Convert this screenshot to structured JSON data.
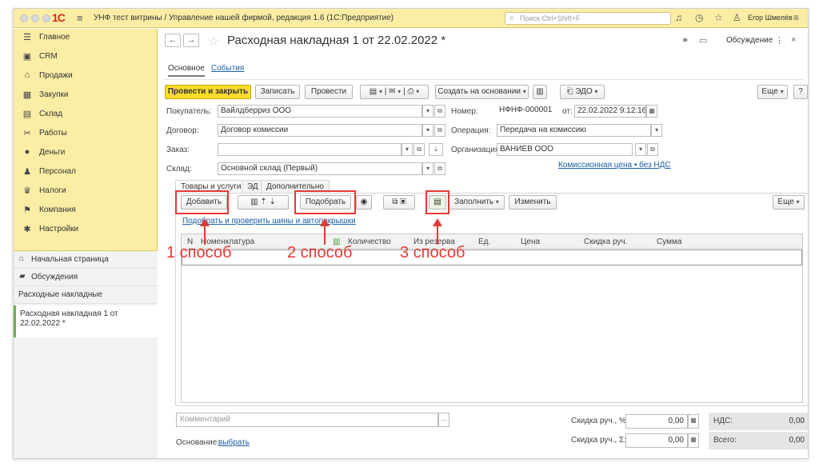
{
  "titlebar": {
    "logo": "1С",
    "app_title": "УНФ тест витрины / Управление нашей фирмой, редакция 1.6  (1С:Предприятие)",
    "search_placeholder": "Поиск Ctrl+Shift+F",
    "user": "Егор Шмелёв"
  },
  "sidebar": {
    "items": [
      {
        "label": "Главное",
        "icon": "menu-icon"
      },
      {
        "label": "CRM",
        "icon": "crm-icon"
      },
      {
        "label": "Продажи",
        "icon": "sales-icon"
      },
      {
        "label": "Закупки",
        "icon": "purchases-icon"
      },
      {
        "label": "Склад",
        "icon": "warehouse-icon"
      },
      {
        "label": "Работы",
        "icon": "works-icon"
      },
      {
        "label": "Деньги",
        "icon": "money-icon"
      },
      {
        "label": "Персонал",
        "icon": "staff-icon"
      },
      {
        "label": "Налоги",
        "icon": "taxes-icon"
      },
      {
        "label": "Компания",
        "icon": "company-icon"
      },
      {
        "label": "Настройки",
        "icon": "settings-icon"
      }
    ],
    "sub": {
      "home": "Начальная страница",
      "discussions": "Обсуждения",
      "invoices": "Расходные накладные",
      "open_window": "Расходная накладная 1 от 22.02.2022 *"
    }
  },
  "doc": {
    "title": "Расходная накладная 1 от 22.02.2022 *",
    "discuss": "Обсуждение",
    "tabs": {
      "main": "Основное",
      "events": "События"
    },
    "toolbar": {
      "post_close": "Провести и закрыть",
      "save": "Записать",
      "post": "Провести",
      "create_based": "Создать на основании",
      "edo": "ЭДО",
      "more": "Еще",
      "help": "?"
    },
    "fields": {
      "buyer_label": "Покупатель:",
      "buyer": "Вайлдберриз ООО",
      "contract_label": "Договор:",
      "contract": "Договор комиссии",
      "order_label": "Заказ:",
      "order": "",
      "warehouse_label": "Склад:",
      "warehouse": "Основной склад (Первый)",
      "number_label": "Номер:",
      "number": "НФНФ-000001",
      "date_label": "от:",
      "date": "22.02.2022  9:12:16",
      "operation_label": "Операция:",
      "operation": "Передача на комиссию",
      "org_label": "Организация:",
      "org": "ВАНИЕВ ООО",
      "price_link": "Комиссионная цена • без НДС"
    },
    "page_tabs": {
      "goods": "Товары и услуги",
      "ed": "ЭД",
      "extra": "Дополнительно"
    },
    "table_toolbar": {
      "add": "Добавить",
      "pick": "Подобрать",
      "fill": "Заполнить",
      "change": "Изменить",
      "more": "Еще",
      "tires_link": "Подобрать и проверить шины и автопокрышки"
    },
    "columns": [
      "N",
      "Номенклатура",
      "Количество",
      "Из резерва",
      "Ед.",
      "Цена",
      "Скидка руч.",
      "Сумма"
    ],
    "annotations": [
      "1 способ",
      "2 способ",
      "3 способ"
    ],
    "footer": {
      "comment_placeholder": "Комментарий",
      "basis_label": "Основание:",
      "basis_link": "выбрать",
      "discount_pct_label": "Скидка руч., %:",
      "discount_pct": "0,00",
      "discount_sum_label": "Скидка руч., Σ:",
      "discount_sum": "0,00",
      "vat_label": "НДС:",
      "vat": "0,00",
      "total_label": "Всего:",
      "total": "0,00"
    }
  },
  "colors": {
    "accent_yellow": "#fbdc2c",
    "sidebar_bg": "#fbeda4",
    "annotation_red": "#e53935",
    "link_blue": "#1a5da6"
  }
}
